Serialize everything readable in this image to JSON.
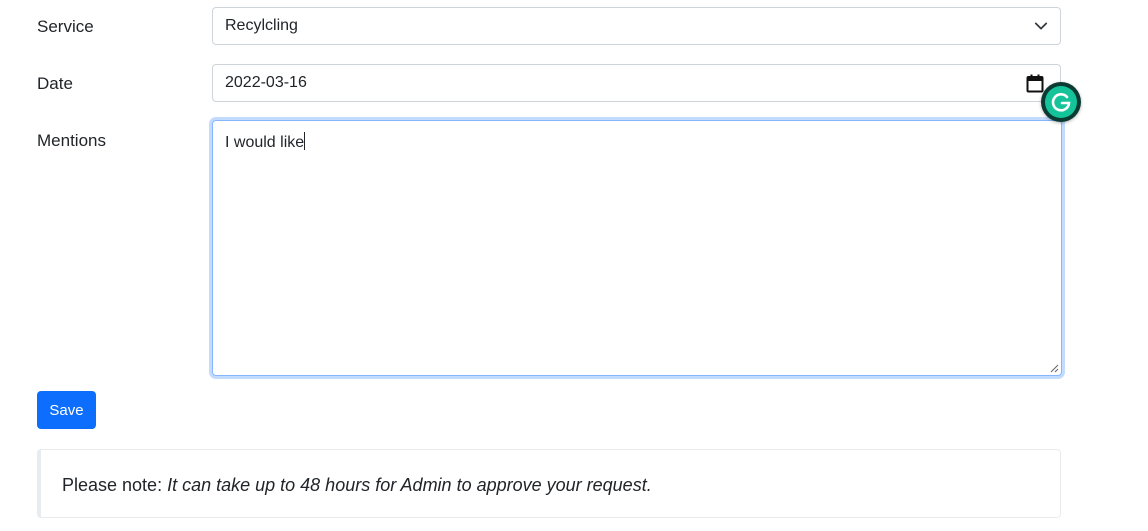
{
  "form": {
    "service": {
      "label": "Service",
      "value": "Recylcling"
    },
    "date": {
      "label": "Date",
      "value": "2022-03-16"
    },
    "mentions": {
      "label": "Mentions",
      "value": "I would like"
    },
    "save_label": "Save"
  },
  "note": {
    "prefix": "Please note: ",
    "message": "It can take up to 48 hours for Admin to approve your request."
  },
  "colors": {
    "primary": "#0d6efd",
    "focus_border": "#86b7fe",
    "grammarly": "#15c39a"
  },
  "icons": [
    "chevron-down-icon",
    "calendar-icon",
    "grammarly-icon",
    "resize-handle-icon"
  ]
}
